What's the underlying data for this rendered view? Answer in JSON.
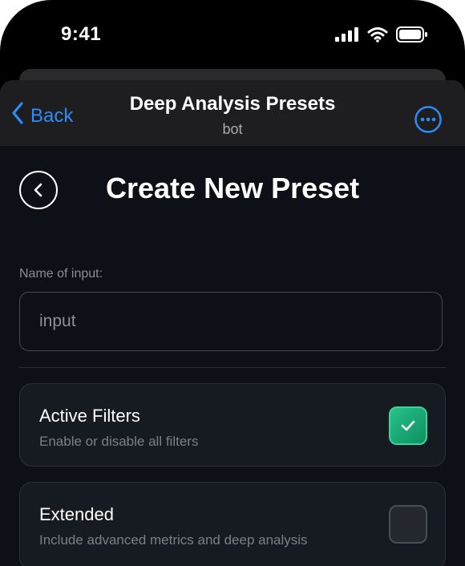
{
  "status": {
    "time": "9:41"
  },
  "navbar": {
    "back_label": "Back",
    "title": "Deep Analysis Presets",
    "subtitle": "bot"
  },
  "page": {
    "title": "Create New Preset"
  },
  "form": {
    "name_label": "Name of input:",
    "name_placeholder": "input",
    "name_value": ""
  },
  "options": [
    {
      "title": "Active Filters",
      "description": "Enable or disable all filters",
      "checked": true
    },
    {
      "title": "Extended",
      "description": "Include advanced metrics and deep analysis",
      "checked": false
    }
  ],
  "colors": {
    "accent_blue": "#2f8bf7",
    "check_green": "#1fae74",
    "background": "#0d1016"
  }
}
